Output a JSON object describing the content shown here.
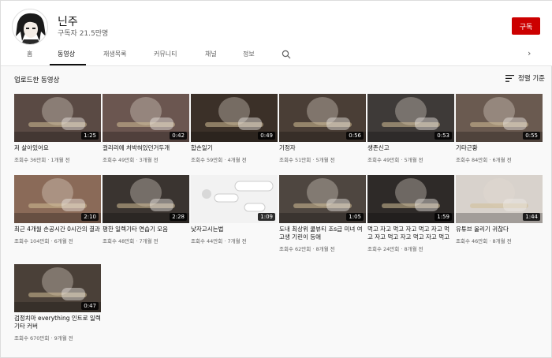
{
  "channel": {
    "name": "닌주",
    "subscribers": "구독자 21.5만명",
    "subscribe_label": "구독"
  },
  "tabs": [
    {
      "label": "홈"
    },
    {
      "label": "동영상"
    },
    {
      "label": "재생목록"
    },
    {
      "label": "커뮤니티"
    },
    {
      "label": "채널"
    },
    {
      "label": "정보"
    }
  ],
  "section": {
    "title": "업로드한 동영상",
    "sort_label": "정렬 기준"
  },
  "videos": [
    {
      "title": "저 살아있어요",
      "views": "조회수 36만회",
      "age": "1개월 전",
      "duration": "1:25"
    },
    {
      "title": "걸리리에 처박혀있던거두개",
      "views": "조회수 49만회",
      "age": "3개월 전",
      "duration": "0:42"
    },
    {
      "title": "합손일기",
      "views": "조회수 59만회",
      "age": "4개월 전",
      "duration": "0:49"
    },
    {
      "title": "기정자",
      "views": "조회수 51만회",
      "age": "5개월 전",
      "duration": "0:56"
    },
    {
      "title": "생존신고",
      "views": "조회수 49만회",
      "age": "5개월 전",
      "duration": "0:53"
    },
    {
      "title": "기타근황",
      "views": "조회수 84만회",
      "age": "6개월 전",
      "duration": "0:55"
    },
    {
      "title": "최근 4개월 손공시간 0시간의 결과",
      "views": "조회수 104만회",
      "age": "6개월 전",
      "duration": "2:10"
    },
    {
      "title": "평한 일렉기타 연습기 모음",
      "views": "조회수 48만회",
      "age": "7개월 전",
      "duration": "2:28"
    },
    {
      "title": "낮자고시는법",
      "views": "조회수 44만회",
      "age": "7개월 전",
      "duration": "1:09"
    },
    {
      "title": "도내 최상위 쿨뷰티 조s급 미녀 여고생 기린이 등애",
      "views": "조회수 62만회",
      "age": "8개월 전",
      "duration": "1:05"
    },
    {
      "title": "먹고 자고 먹고 자고 먹고 자고 먹고 자고 먹고 자고 먹고 자고 먹고",
      "views": "조회수 24만회",
      "age": "8개월 전",
      "duration": "1:59"
    },
    {
      "title": "유튜브 올리기 귀찮다",
      "views": "조회수 46만회",
      "age": "8개월 전",
      "duration": "1:44"
    },
    {
      "title": "검정치마 everything 인트로 일렉기타 커버",
      "views": "조회수 670만회",
      "age": "9개월 전",
      "duration": "0:47"
    }
  ],
  "thumb_colors": [
    "#5a4a44",
    "#6b5650",
    "#3b3028",
    "#4a3e36",
    "#3e3a38",
    "#6a5a50",
    "#8a6a58",
    "#3a3430",
    "#f2f2f2",
    "#4e4640",
    "#2e2a28",
    "#d8d2cc",
    "#4a4038"
  ],
  "accent_color": "#cc0000"
}
